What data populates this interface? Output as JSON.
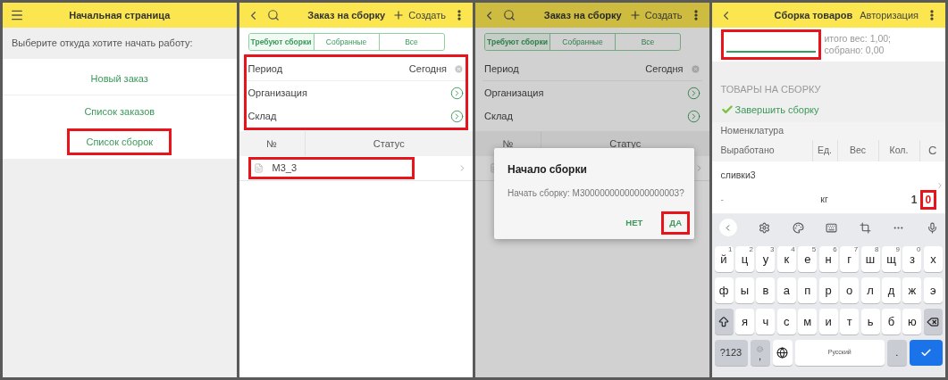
{
  "screens": [
    {
      "kind": "home",
      "header": {
        "title": "Начальная страница"
      },
      "prompt": "Выберите откуда хотите начать работу:",
      "links": [
        {
          "label": "Новый заказ",
          "highlighted": false
        },
        {
          "label": "Список заказов",
          "highlighted": false
        },
        {
          "label": "Список сборок",
          "highlighted": true
        }
      ]
    },
    {
      "kind": "list",
      "dimmed": false,
      "header": {
        "title": "Заказ на сборку",
        "action": "Создать"
      },
      "tabs": [
        {
          "label": "Требуют сборки",
          "selected": true
        },
        {
          "label": "Собранные",
          "selected": false
        },
        {
          "label": "Все",
          "selected": false
        }
      ],
      "filters_highlighted": true,
      "filters": [
        {
          "kind": "clearable",
          "label": "Период",
          "value": "Сегодня"
        },
        {
          "kind": "select",
          "label": "Организация"
        },
        {
          "kind": "select",
          "label": "Склад"
        }
      ],
      "columns": [
        "№",
        "Статус"
      ],
      "rows": [
        {
          "number": "М3_3",
          "highlighted": true
        }
      ]
    },
    {
      "kind": "list",
      "dimmed": true,
      "header": {
        "title": "Заказ на сборку",
        "action": "Создать"
      },
      "tabs": [
        {
          "label": "Требуют сборки",
          "selected": true
        },
        {
          "label": "Собранные",
          "selected": false
        },
        {
          "label": "Все",
          "selected": false
        }
      ],
      "filters_highlighted": false,
      "filters": [
        {
          "kind": "clearable",
          "label": "Период",
          "value": "Сегодня"
        },
        {
          "kind": "select",
          "label": "Организация"
        },
        {
          "kind": "select",
          "label": "Склад"
        }
      ],
      "columns": [
        "№",
        "Статус"
      ],
      "rows": [
        {
          "highlighted": false
        }
      ],
      "dialog": {
        "title": "Начало сборки",
        "message": "Начать сборку: М30000000000000000003?",
        "buttons": [
          {
            "label": "НЕТ",
            "highlighted": false
          },
          {
            "label": "ДА",
            "highlighted": true
          }
        ]
      }
    },
    {
      "kind": "assembly",
      "header": {
        "title": "Сборка товаров",
        "action": "Авторизация"
      },
      "weight_field_highlighted": true,
      "totals": [
        "итого вес: 1,00;",
        "собрано: 0,00"
      ],
      "section_title": "ТОВАРЫ НА СБОРКУ",
      "complete_button": "Завершить сборку",
      "column_title": "Номенклатура",
      "columns": [
        "Выработано",
        "Ед.",
        "Вес",
        "Кол.",
        "С"
      ],
      "items": [
        {
          "name": "сливки3",
          "produced": "-",
          "unit": "кг",
          "quantity": "1",
          "column_5": "0",
          "column_5_highlighted": true
        }
      ],
      "keyboard": {
        "rows": [
          [
            {
              "kind": "letter",
              "label": "й",
              "hint": "1"
            },
            {
              "kind": "letter",
              "label": "ц",
              "hint": "2"
            },
            {
              "kind": "letter",
              "label": "у",
              "hint": "3"
            },
            {
              "kind": "letter",
              "label": "к",
              "hint": "4"
            },
            {
              "kind": "letter",
              "label": "е",
              "hint": "5"
            },
            {
              "kind": "letter",
              "label": "н",
              "hint": "6"
            },
            {
              "kind": "letter",
              "label": "г",
              "hint": "7"
            },
            {
              "kind": "letter",
              "label": "ш",
              "hint": "8"
            },
            {
              "kind": "letter",
              "label": "щ",
              "hint": "9"
            },
            {
              "kind": "letter",
              "label": "з",
              "hint": "0"
            },
            {
              "kind": "letter",
              "label": "х"
            }
          ],
          [
            {
              "kind": "letter",
              "label": "ф"
            },
            {
              "kind": "letter",
              "label": "ы"
            },
            {
              "kind": "letter",
              "label": "в"
            },
            {
              "kind": "letter",
              "label": "а"
            },
            {
              "kind": "letter",
              "label": "п"
            },
            {
              "kind": "letter",
              "label": "р"
            },
            {
              "kind": "letter",
              "label": "о"
            },
            {
              "kind": "letter",
              "label": "л"
            },
            {
              "kind": "letter",
              "label": "д"
            },
            {
              "kind": "letter",
              "label": "ж"
            },
            {
              "kind": "letter",
              "label": "э"
            }
          ],
          [
            {
              "kind": "shift"
            },
            {
              "kind": "letter",
              "label": "я"
            },
            {
              "kind": "letter",
              "label": "ч"
            },
            {
              "kind": "letter",
              "label": "с"
            },
            {
              "kind": "letter",
              "label": "м"
            },
            {
              "kind": "letter",
              "label": "и"
            },
            {
              "kind": "letter",
              "label": "т"
            },
            {
              "kind": "letter",
              "label": "ь"
            },
            {
              "kind": "letter",
              "label": "б"
            },
            {
              "kind": "letter",
              "label": "ю"
            },
            {
              "kind": "backspace"
            }
          ]
        ],
        "symbols_key": "?123",
        "comma_key": ",",
        "space_key": "Русский",
        "period_key": "."
      }
    }
  ]
}
